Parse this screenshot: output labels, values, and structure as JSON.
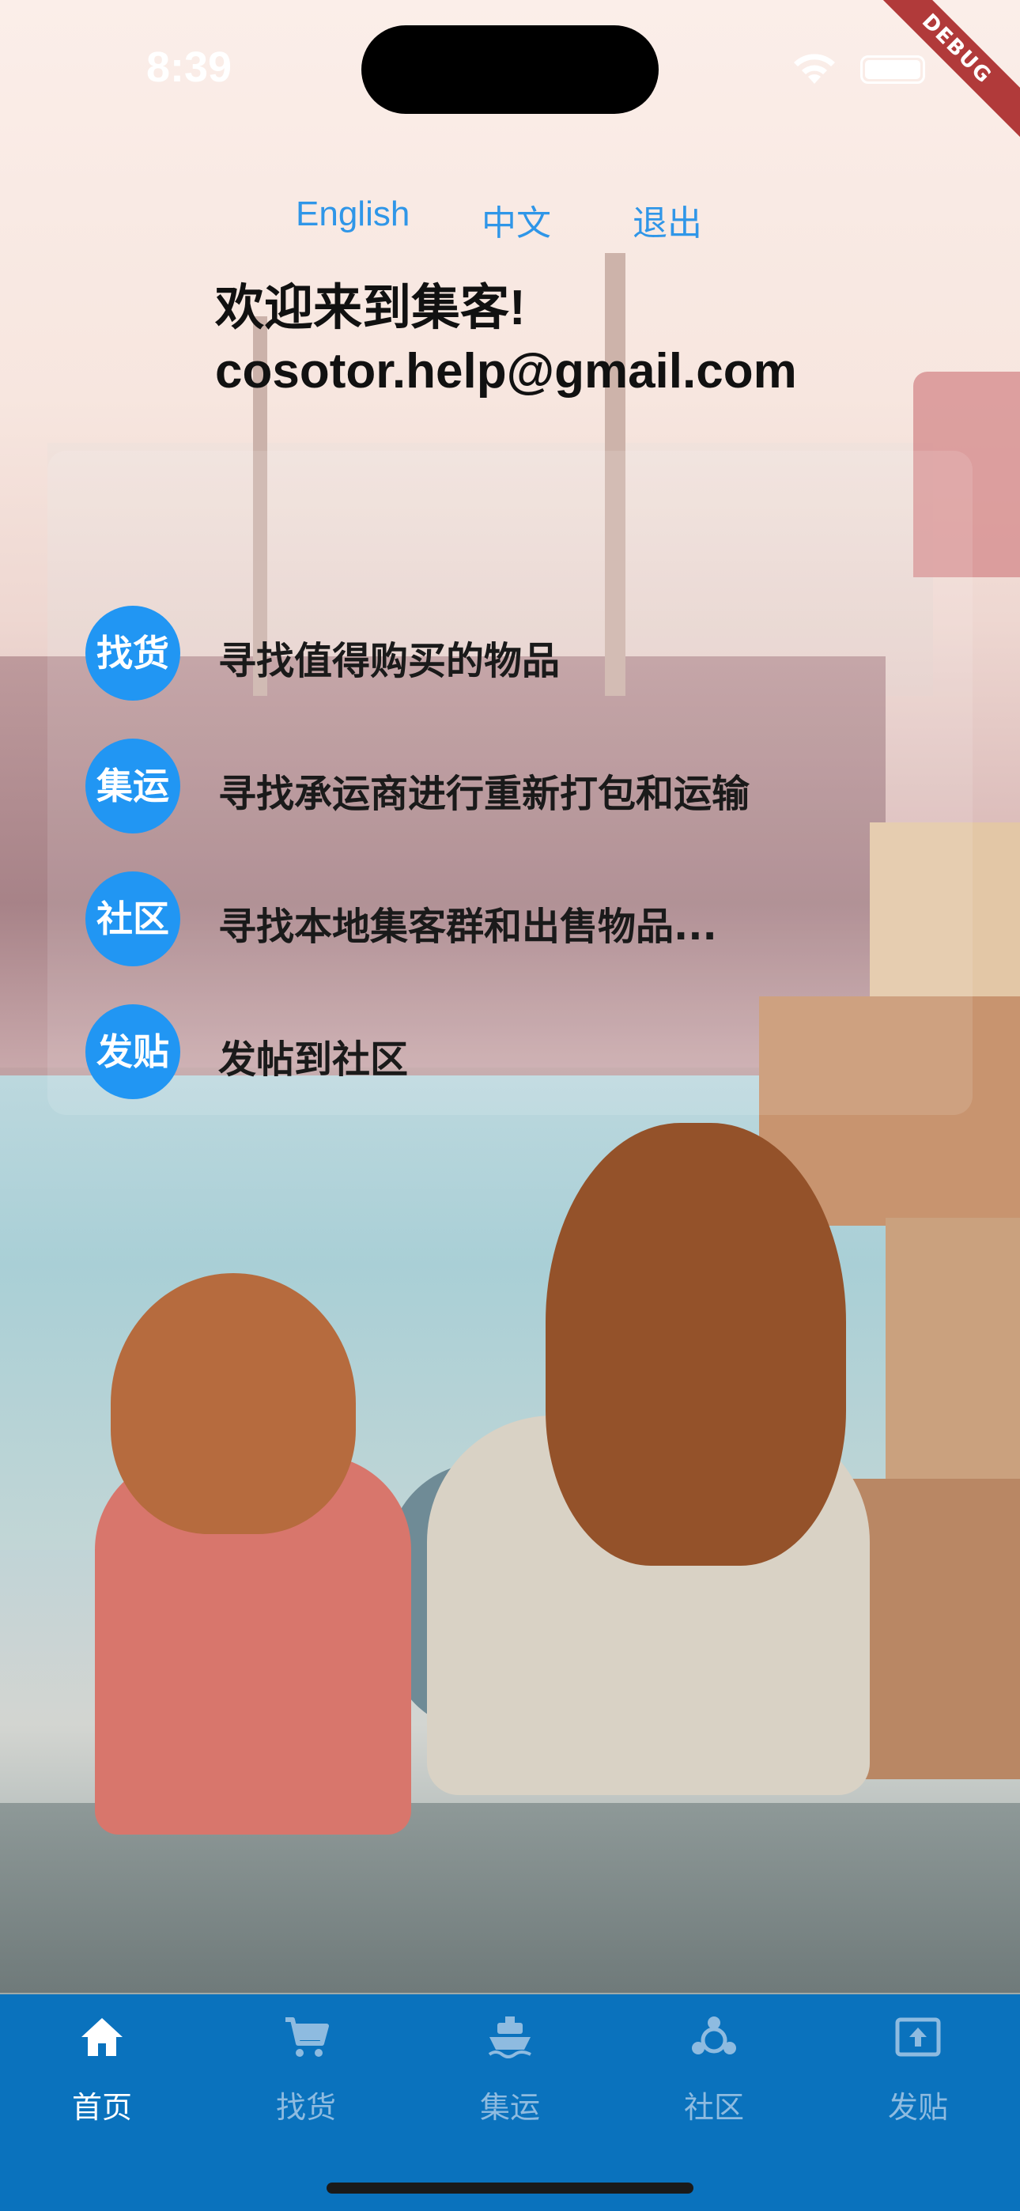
{
  "status_bar": {
    "time": "8:39",
    "debug_label": "DEBUG"
  },
  "header_links": {
    "english": "English",
    "chinese": "中文",
    "logout": "退出"
  },
  "welcome": {
    "line1": "欢迎来到集客!",
    "line2": "cosotor.help@gmail.com"
  },
  "menu": [
    {
      "badge": "找货",
      "text": "寻找值得购买的物品"
    },
    {
      "badge": "集运",
      "text": "寻找承运商进行重新打包和运输"
    },
    {
      "badge": "社区",
      "text": "寻找本地集客群和出售物品..."
    },
    {
      "badge": "发贴",
      "text": "发帖到社区"
    }
  ],
  "bottom_nav": {
    "items": [
      {
        "label": "首页",
        "icon": "home-icon"
      },
      {
        "label": "找货",
        "icon": "cart-icon"
      },
      {
        "label": "集运",
        "icon": "ship-icon"
      },
      {
        "label": "社区",
        "icon": "community-icon"
      },
      {
        "label": "发贴",
        "icon": "upload-icon"
      }
    ],
    "active_index": 0
  },
  "colors": {
    "accent": "#2196f3",
    "nav_bg": "#0a72bd",
    "link": "#2f96e8"
  }
}
